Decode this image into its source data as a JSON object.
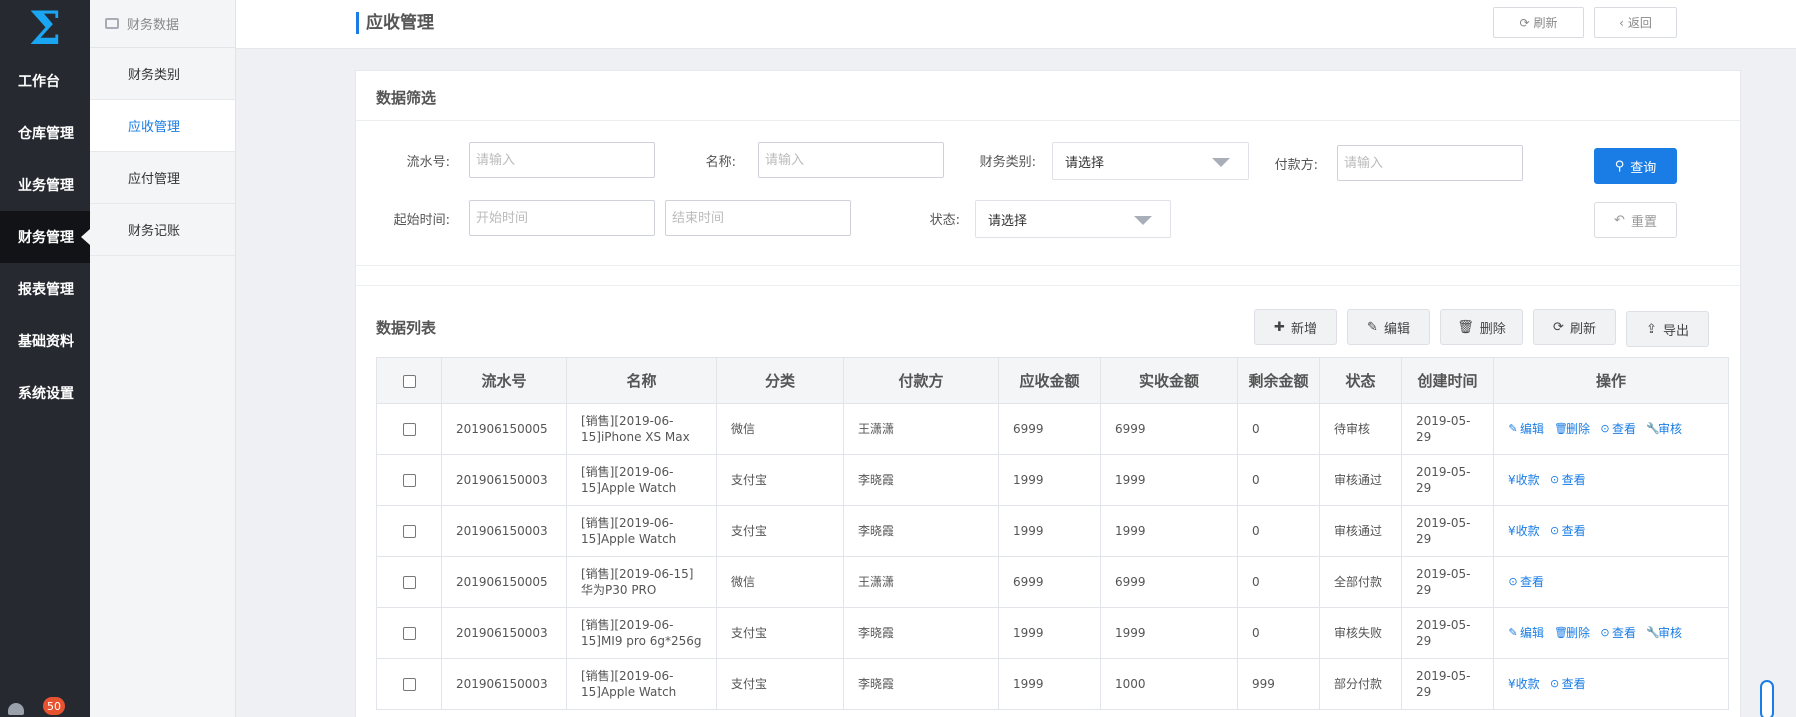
{
  "nav": {
    "logo": "Σ",
    "items": [
      {
        "label": "工作台"
      },
      {
        "label": "仓库管理"
      },
      {
        "label": "业务管理"
      },
      {
        "label": "财务管理"
      },
      {
        "label": "报表管理"
      },
      {
        "label": "基础资料"
      },
      {
        "label": "系统设置"
      }
    ],
    "active_index": 3,
    "notification_count": "50"
  },
  "subnav": {
    "header": "财务数据",
    "items": [
      {
        "label": "财务类别"
      },
      {
        "label": "应收管理"
      },
      {
        "label": "应付管理"
      },
      {
        "label": "财务记账"
      }
    ],
    "active_index": 1
  },
  "header": {
    "title": "应收管理",
    "refresh_label": "刷新",
    "back_label": "返回"
  },
  "filter": {
    "title": "数据筛选",
    "serial_label": "流水号:",
    "serial_placeholder": "请输入",
    "name_label": "名称:",
    "name_placeholder": "请输入",
    "category_label": "财务类别:",
    "category_value": "请选择",
    "payer_label": "付款方:",
    "payer_placeholder": "请输入",
    "start_label": "起始时间:",
    "start_placeholder": "开始时间",
    "end_placeholder": "结束时间",
    "status_label": "状态:",
    "status_value": "请选择",
    "query_label": "查询",
    "reset_label": "重置"
  },
  "list": {
    "title": "数据列表",
    "toolbar": {
      "add": "新增",
      "edit": "编辑",
      "delete": "删除",
      "refresh": "刷新",
      "export": "导出"
    },
    "columns": [
      "流水号",
      "名称",
      "分类",
      "付款方",
      "应收金额",
      "实收金额",
      "剩余金额",
      "状态",
      "创建时间",
      "操作"
    ],
    "rows": [
      {
        "serial": "201906150005",
        "name": "[销售][2019-06-15]iPhone XS Max",
        "category": "微信",
        "payer": "王潇潇",
        "receivable": "6999",
        "received": "6999",
        "remaining": "0",
        "status": "待审核",
        "created": "2019-05-29",
        "actions": [
          {
            "label": "编辑",
            "icon": "pencil-icon"
          },
          {
            "label": "删除",
            "icon": "trash-icon"
          },
          {
            "label": "查看",
            "icon": "view-icon"
          },
          {
            "label": "审核",
            "icon": "wrench-icon"
          }
        ]
      },
      {
        "serial": "201906150003",
        "name": "[销售][2019-06-15]Apple Watch",
        "category": "支付宝",
        "payer": "李晓霞",
        "receivable": "1999",
        "received": "1999",
        "remaining": "0",
        "status": "审核通过",
        "created": "2019-05-29",
        "actions": [
          {
            "label": "¥收款",
            "icon": ""
          },
          {
            "label": "查看",
            "icon": "view-icon"
          }
        ]
      },
      {
        "serial": "201906150003",
        "name": "[销售][2019-06-15]Apple Watch",
        "category": "支付宝",
        "payer": "李晓霞",
        "receivable": "1999",
        "received": "1999",
        "remaining": "0",
        "status": "审核通过",
        "created": "2019-05-29",
        "actions": [
          {
            "label": "¥收款",
            "icon": ""
          },
          {
            "label": "查看",
            "icon": "view-icon"
          }
        ]
      },
      {
        "serial": "201906150005",
        "name": "[销售][2019-06-15]华为P30 PRO",
        "category": "微信",
        "payer": "王潇潇",
        "receivable": "6999",
        "received": "6999",
        "remaining": "0",
        "status": "全部付款",
        "created": "2019-05-29",
        "actions": [
          {
            "label": "查看",
            "icon": "view-icon"
          }
        ]
      },
      {
        "serial": "201906150003",
        "name": "[销售][2019-06-15]MI9 pro 6g*256g",
        "category": "支付宝",
        "payer": "李晓霞",
        "receivable": "1999",
        "received": "1999",
        "remaining": "0",
        "status": "审核失败",
        "created": "2019-05-29",
        "actions": [
          {
            "label": "编辑",
            "icon": "pencil-icon"
          },
          {
            "label": "删除",
            "icon": "trash-icon"
          },
          {
            "label": "查看",
            "icon": "view-icon"
          },
          {
            "label": "审核",
            "icon": "wrench-icon"
          }
        ]
      },
      {
        "serial": "201906150003",
        "name": "[销售][2019-06-15]Apple Watch",
        "category": "支付宝",
        "payer": "李晓霞",
        "receivable": "1999",
        "received": "1000",
        "remaining": "999",
        "status": "部分付款",
        "created": "2019-05-29",
        "actions": [
          {
            "label": "¥收款",
            "icon": ""
          },
          {
            "label": "查看",
            "icon": "view-icon"
          }
        ]
      }
    ]
  },
  "colors": {
    "accent": "#1a7de6",
    "nav_bg": "#262a30",
    "logo": "#1aa6f2",
    "badge": "#e8532f"
  }
}
